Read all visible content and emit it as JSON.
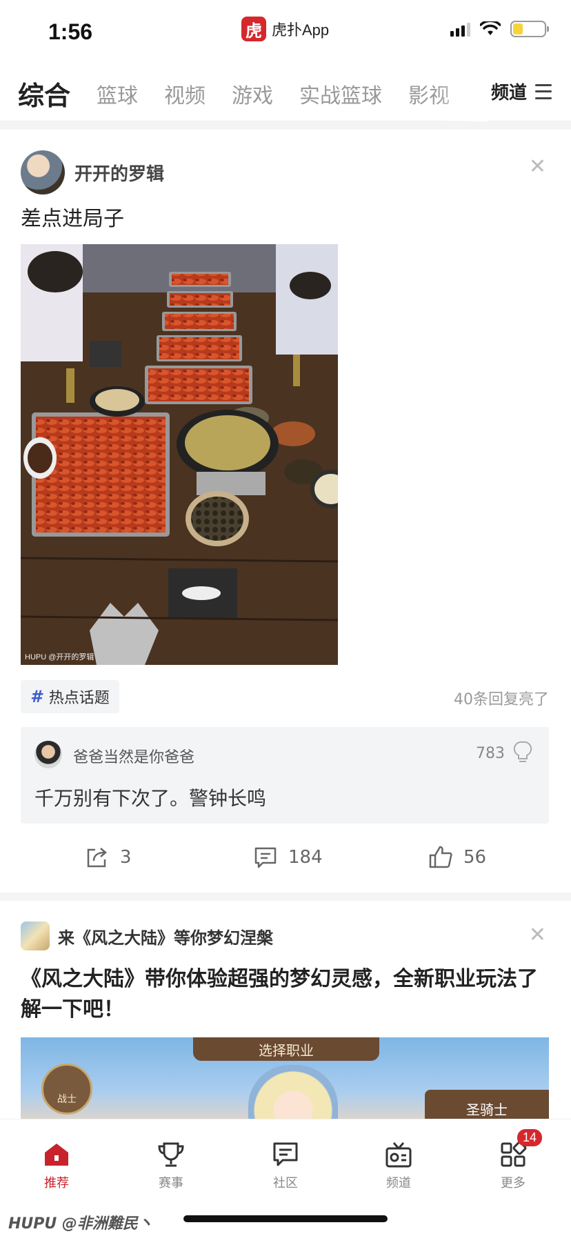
{
  "status_bar": {
    "time": "1:56",
    "app_logo_char": "虎",
    "app_name": "虎扑App"
  },
  "tabs": {
    "items": [
      "综合",
      "篮球",
      "视频",
      "游戏",
      "实战篮球",
      "影视"
    ],
    "active_index": 0,
    "channels_label": "频道"
  },
  "post": {
    "author": "开开的罗辑",
    "title": "差点进局子",
    "image_watermark": "HUPU @开开的罗辑",
    "tag_icon": "#",
    "tag_label": "热点话题",
    "reply_summary": "40条回复亮了",
    "top_comment": {
      "user": "爸爸当然是你爸爸",
      "likes": "783",
      "text": "千万别有下次了。警钟长鸣"
    },
    "actions": {
      "share_count": "3",
      "comment_count": "184",
      "like_count": "56"
    }
  },
  "ad": {
    "name": "来《风之大陆》等你梦幻涅槃",
    "title": "《风之大陆》带你体验超强的梦幻灵感，全新职业玩法了解一下吧！",
    "image_banner": "选择职业",
    "image_badge_left": "战士",
    "image_badge_right": "圣骑士"
  },
  "bottom_nav": {
    "items": [
      {
        "label": "推荐",
        "icon": "home-icon"
      },
      {
        "label": "赛事",
        "icon": "trophy-icon"
      },
      {
        "label": "社区",
        "icon": "chat-icon"
      },
      {
        "label": "频道",
        "icon": "radio-icon"
      },
      {
        "label": "更多",
        "icon": "grid-icon"
      }
    ],
    "more_badge": "14"
  },
  "watermark": "HUPU @非洲難民丶",
  "colors": {
    "brand_red": "#d5282d",
    "tag_blue": "#3e5ccf"
  }
}
